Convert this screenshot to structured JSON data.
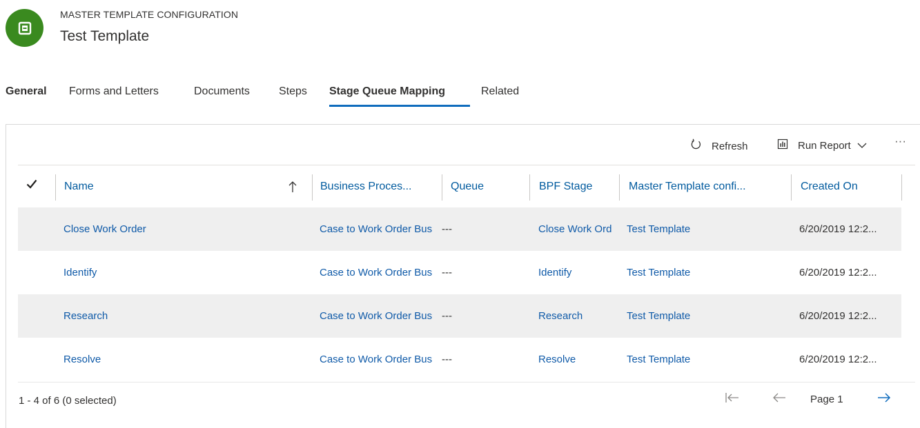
{
  "header": {
    "entity_type": "MASTER TEMPLATE CONFIGURATION",
    "record_title": "Test Template",
    "avatar_color": "#3a8a1f",
    "avatar_icon": "entity-icon"
  },
  "tabs": [
    {
      "label": "General",
      "active": false
    },
    {
      "label": "Forms and Letters",
      "active": false
    },
    {
      "label": "Documents",
      "active": false
    },
    {
      "label": "Steps",
      "active": false
    },
    {
      "label": "Stage Queue Mapping",
      "active": true
    },
    {
      "label": "Related",
      "active": false
    }
  ],
  "commands": {
    "refresh_label": "Refresh",
    "run_report_label": "Run Report",
    "more_label": "···"
  },
  "grid": {
    "columns": [
      {
        "label": "Name",
        "sorted": "ascending"
      },
      {
        "label": "Business Proces..."
      },
      {
        "label": "Queue"
      },
      {
        "label": "BPF Stage"
      },
      {
        "label": "Master Template confi..."
      },
      {
        "label": "Created On"
      }
    ],
    "rows": [
      {
        "name": "Close Work Order",
        "business_process": "Case to Work Order Bus",
        "queue": "---",
        "bpf_stage": "Close Work Ord",
        "master_template": "Test Template",
        "created_on": "6/20/2019 12:2..."
      },
      {
        "name": "Identify",
        "business_process": "Case to Work Order Bus",
        "queue": "---",
        "bpf_stage": "Identify",
        "master_template": "Test Template",
        "created_on": "6/20/2019 12:2..."
      },
      {
        "name": "Research",
        "business_process": "Case to Work Order Bus",
        "queue": "---",
        "bpf_stage": "Research",
        "master_template": "Test Template",
        "created_on": "6/20/2019 12:2..."
      },
      {
        "name": "Resolve",
        "business_process": "Case to Work Order Bus",
        "queue": "---",
        "bpf_stage": "Resolve",
        "master_template": "Test Template",
        "created_on": "6/20/2019 12:2..."
      }
    ],
    "status": "1 - 4 of 6 (0 selected)",
    "page_label": "Page 1"
  },
  "colors": {
    "link": "#0f5aa8",
    "accent": "#0f6cbd",
    "row_shade": "#efefef"
  }
}
